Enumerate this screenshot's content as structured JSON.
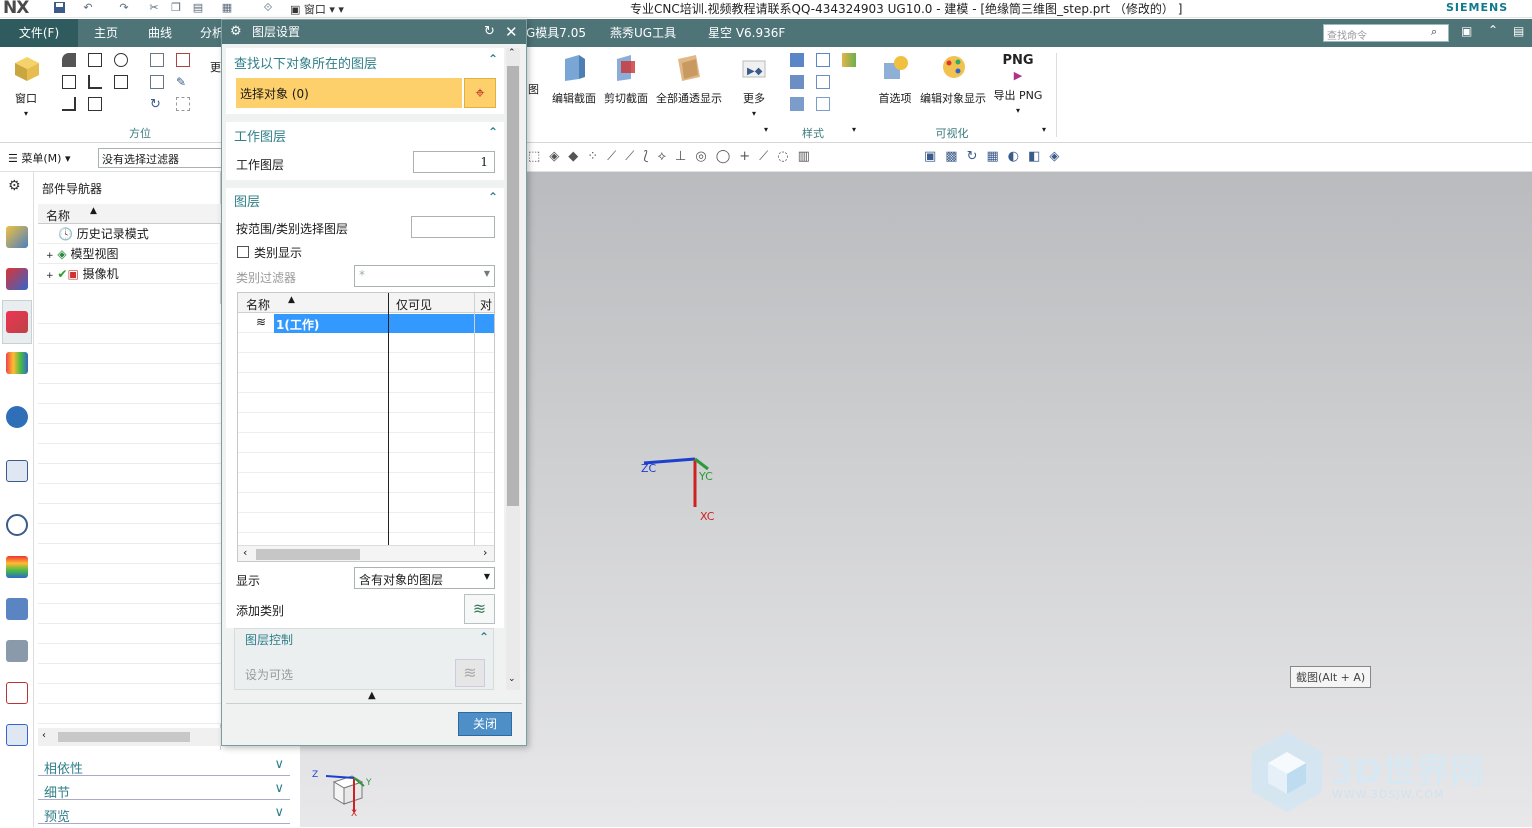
{
  "titlebar": {
    "logo": "NX",
    "title": "专业CNC培训.视频教程请联系QQ-434324903 UG10.0 - 建模 - [绝缘筒三维图_step.prt  （修改的） ]",
    "brand": "SIEMENS",
    "window_menu": "窗口"
  },
  "menubar": {
    "file": "文件(F)",
    "tabs": [
      "主页",
      "曲线",
      "分析",
      "G模具7.05",
      "燕秀UG工具",
      "星空 V6.936F"
    ],
    "search_placeholder": "查找命令"
  },
  "ribbon": {
    "window_label": "窗口",
    "orientation_group": "方位",
    "more_left": "更",
    "section_cut_suffix": "图",
    "buttons": [
      "编辑截面",
      "剪切截面",
      "全部通透显示",
      "更多",
      "首选项",
      "编辑对象显示",
      "导出 PNG"
    ],
    "png_text": "PNG",
    "style_group": "样式",
    "visualize_group": "可视化"
  },
  "toolbar2": {
    "menu_label": "菜单(M)",
    "filter_value": "没有选择过滤器"
  },
  "navigator": {
    "title": "部件导航器",
    "column": "名称",
    "items": [
      "历史记录模式",
      "模型视图",
      "摄像机"
    ],
    "bottom_panels": [
      "相依性",
      "细节",
      "预览"
    ]
  },
  "dialog": {
    "title": "图层设置",
    "sec_find": "查找以下对象所在的图层",
    "select_object": "选择对象 (0)",
    "sec_work": "工作图层",
    "work_label": "工作图层",
    "work_value": "1",
    "sec_layer": "图层",
    "range_label": "按范围/类别选择图层",
    "category_display": "类别显示",
    "category_filter": "类别过滤器",
    "category_filter_value": "*",
    "table_headers": [
      "名称",
      "仅可见",
      "对"
    ],
    "table_row": "1(工作)",
    "display_label": "显示",
    "display_value": "含有对象的图层",
    "add_category": "添加类别",
    "sec_control": "图层控制",
    "set_selectable": "设为可选",
    "close": "关闭"
  },
  "viewport": {
    "axis_zc": "ZC",
    "axis_yc": "YC",
    "axis_xc": "XC",
    "triad_z": "Z",
    "triad_y": "Y",
    "triad_x": "X",
    "tooltip": "截图(Alt + A)",
    "watermark_title": "3D世界网",
    "watermark_url": "WWW.3DSJW.COM"
  }
}
